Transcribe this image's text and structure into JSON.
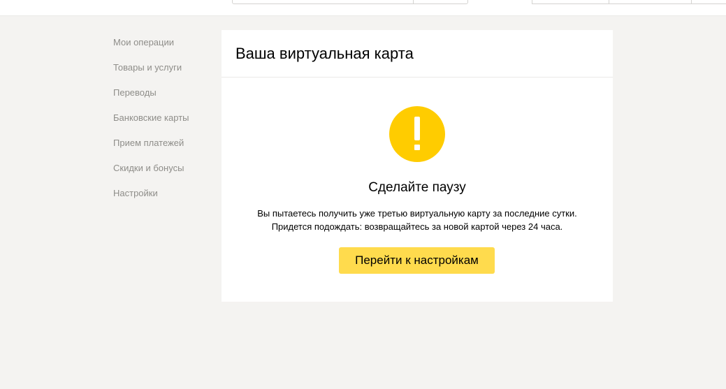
{
  "sidebar": {
    "items": [
      {
        "label": "Мои операции"
      },
      {
        "label": "Товары и услуги"
      },
      {
        "label": "Переводы"
      },
      {
        "label": "Банковские карты"
      },
      {
        "label": "Прием платежей"
      },
      {
        "label": "Скидки и бонусы"
      },
      {
        "label": "Настройки"
      }
    ]
  },
  "panel": {
    "title": "Ваша виртуальная карта",
    "icon": "exclamation-icon",
    "icon_color": "#ffcc00",
    "message_title": "Сделайте паузу",
    "message_line1": "Вы пытаетесь получить уже третью виртуальную карту за последние сутки.",
    "message_line2": "Придется подождать: возвращайтесь за новой картой через 24 часа.",
    "button_label": "Перейти к настройкам",
    "button_color": "#ffdb4d"
  }
}
